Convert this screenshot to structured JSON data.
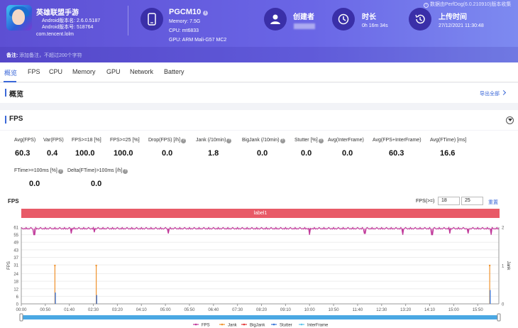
{
  "header": {
    "app_name": "英雄联盟手游",
    "android_version_name": "Android版本名: 2.6.0.5187",
    "android_version_code": "Android版本号: 518764",
    "package": "com.tencent.lolm",
    "device_name": "PGCM10",
    "memory": "Memory: 7.5G",
    "cpu": "CPU: mt6833",
    "gpu": "GPU: ARM Mali-G57 MC2",
    "creator_title": "创建者",
    "duration_title": "时长",
    "duration_value": "0h 16m 34s",
    "upload_title": "上传时间",
    "upload_value": "27/12/2021 11:30:48",
    "source_note": "数据由PerfDog(6.0.210910)版本收集",
    "remark_label": "备注:",
    "remark_placeholder": "添加备注，不超过200个字符"
  },
  "tabs": [
    "概览",
    "FPS",
    "CPU",
    "Memory",
    "GPU",
    "Network",
    "Battery"
  ],
  "overview": {
    "title": "概览",
    "export_label": "导出全部"
  },
  "fps_section": {
    "title": "FPS",
    "metrics_row1": [
      {
        "label": "Avg(FPS)",
        "value": "60.3"
      },
      {
        "label": "Var(FPS)",
        "value": "0.4"
      },
      {
        "label": "FPS>=18 [%]",
        "value": "100.0"
      },
      {
        "label": "FPS>=25 [%]",
        "value": "100.0"
      },
      {
        "label": "Drop(FPS) [/h]",
        "value": "0.0"
      },
      {
        "label": "Jank (/10min)",
        "value": "1.8"
      },
      {
        "label": "BigJank (/10min)",
        "value": "0.0"
      },
      {
        "label": "Stutter [%]",
        "value": "0.0"
      },
      {
        "label": "Avg(InterFrame)",
        "value": "0.0"
      },
      {
        "label": "Avg(FPS+InterFrame)",
        "value": "60.3"
      },
      {
        "label": "Avg(FTime) [ms]",
        "value": "16.6"
      }
    ],
    "metrics_row2": [
      {
        "label": "FTime>=100ms [%]",
        "value": "0.0"
      },
      {
        "label": "Delta(FTime)>100ms [/h]",
        "value": "0.0"
      }
    ],
    "chart_title": "FPS",
    "fps_ge_label": "FPS(>=)",
    "fps_threshold_1": "18",
    "fps_threshold_2": "25",
    "reset_label": "重置",
    "label_bar": "label1"
  },
  "chart_data": {
    "type": "line",
    "title": "FPS",
    "ylabel": "FPS",
    "y2label": "Jank",
    "y_ticks": [
      0,
      6,
      12,
      18,
      24,
      31,
      37,
      43,
      49,
      55,
      61
    ],
    "y2_ticks": [
      0,
      1,
      2
    ],
    "ylim": [
      0,
      61
    ],
    "y2lim": [
      0,
      2
    ],
    "x_ticks": [
      "00:00",
      "00:50",
      "01:40",
      "02:30",
      "03:20",
      "04:10",
      "05:00",
      "05:50",
      "06:40",
      "07:30",
      "08:20",
      "09:10",
      "10:00",
      "10:50",
      "11:40",
      "12:30",
      "13:20",
      "14:10",
      "15:00",
      "15:50"
    ],
    "x_range_seconds": [
      0,
      994
    ],
    "series": [
      {
        "name": "FPS",
        "color": "#c0399a",
        "baseline": 60,
        "dips": [
          [
            27,
            55
          ],
          [
            104,
            56
          ],
          [
            152,
            57
          ],
          [
            306,
            56
          ],
          [
            600,
            55
          ],
          [
            715,
            56
          ],
          [
            794,
            55
          ],
          [
            855,
            55
          ],
          [
            892,
            56
          ],
          [
            930,
            56
          ],
          [
            978,
            55
          ]
        ]
      },
      {
        "name": "Jank",
        "color": "#f0922c",
        "points": [
          [
            70,
            1
          ],
          [
            156,
            1
          ],
          [
            975,
            1
          ]
        ]
      },
      {
        "name": "BigJank",
        "color": "#e23a3a",
        "points": []
      },
      {
        "name": "Stutter",
        "color": "#3b76d8",
        "points": [
          [
            70,
            9
          ],
          [
            156,
            7
          ],
          [
            975,
            11
          ]
        ]
      },
      {
        "name": "InterFrame",
        "color": "#5fc3ea",
        "points": []
      }
    ],
    "legend_position": "bottom",
    "grid": true
  }
}
